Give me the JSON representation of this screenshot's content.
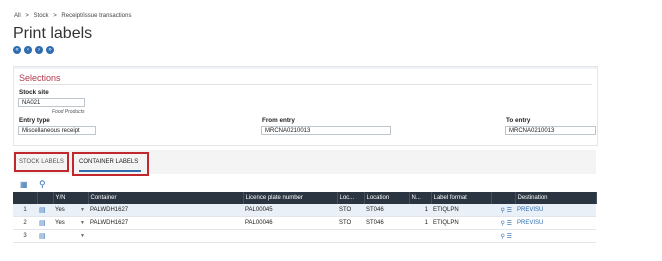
{
  "breadcrumb": [
    "All",
    ">",
    "Stock",
    ">",
    "Receipt/issue transactions"
  ],
  "page_title": "Print labels",
  "nav_buttons": [
    "first-icon",
    "previous-icon",
    "next-icon",
    "last-icon"
  ],
  "selections": {
    "title": "Selections",
    "stock_site_label": "Stock site",
    "stock_site_value": "NA021",
    "stock_site_hint": "Food Products",
    "entry_type_label": "Entry type",
    "entry_type_value": "Miscellaneous receipt",
    "from_entry_label": "From entry",
    "from_entry_value": "MRCNA0210013",
    "to_entry_label": "To entry",
    "to_entry_value": "MRCNA0210013"
  },
  "tabs": [
    "STOCK LABELS",
    "CONTAINER LABELS"
  ],
  "grid": {
    "columns": [
      "",
      "",
      "Y/N",
      "Container",
      "Licence plate number",
      "Loc...",
      "Location",
      "N...",
      "Label format",
      "",
      "Destination"
    ],
    "rows": [
      {
        "num": "1",
        "yn": "Yes",
        "container": "PALWDH1627",
        "lpn": "PAL00045",
        "loc": "STO",
        "location": "ST046",
        "n": "1",
        "format": "ETIQLPN",
        "destination": "PREVISU"
      },
      {
        "num": "2",
        "yn": "Yes",
        "container": "PALWDH1627",
        "lpn": "PAL00046",
        "loc": "STO",
        "location": "ST046",
        "n": "1",
        "format": "ETIQLPN",
        "destination": "PREVISU"
      },
      {
        "num": "3",
        "yn": "",
        "container": "",
        "lpn": "",
        "loc": "",
        "location": "",
        "n": "",
        "format": "",
        "destination": ""
      }
    ]
  },
  "colors": {
    "accent": "#2f6cb0",
    "title_red": "#b5364a",
    "highlight": "#c0282e",
    "header_bg": "#2b3542"
  }
}
